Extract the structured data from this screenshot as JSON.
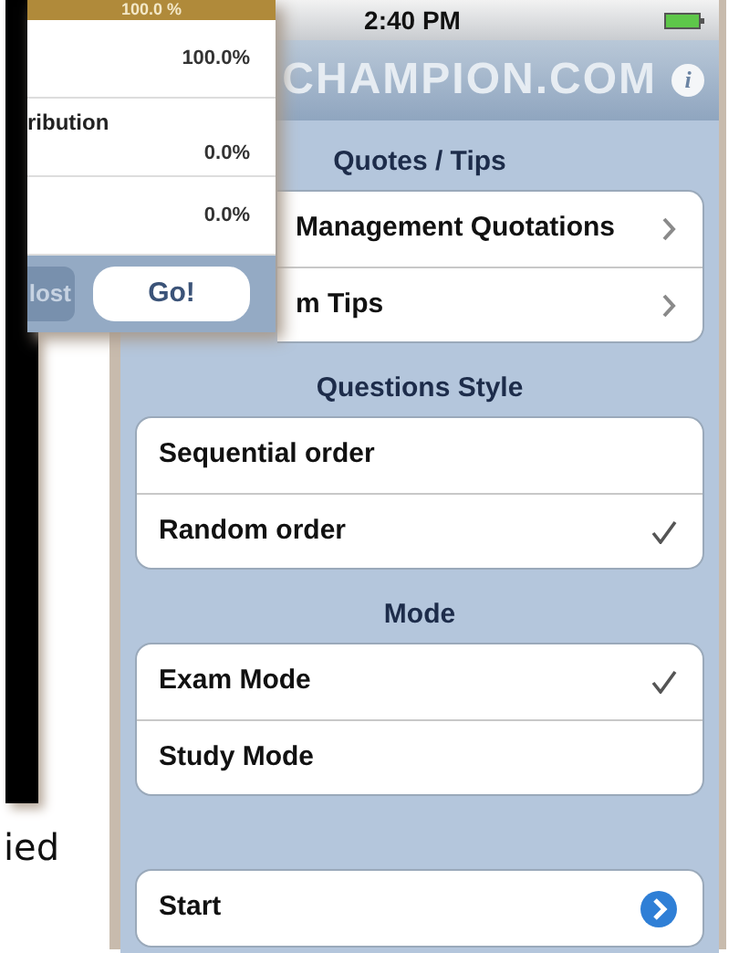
{
  "back_screen": {
    "header": "100.0 %",
    "rows": [
      {
        "label": "",
        "value": "100.0%"
      },
      {
        "label": "ribution",
        "value": "0.0%"
      },
      {
        "label": "",
        "value": "0.0%"
      }
    ],
    "buttons": [
      {
        "label": "lost",
        "kind": "secondary"
      },
      {
        "label": "Go!",
        "kind": "primary"
      }
    ]
  },
  "caption": "ied",
  "phone": {
    "status_bar": {
      "time": "2:40 PM"
    },
    "nav_title": "CHAMPION.COM",
    "info_button": "i",
    "sections": [
      {
        "title": "Quotes / Tips",
        "rows": [
          {
            "label": "Management Quotations",
            "kind": "chevron"
          },
          {
            "label": "m Tips",
            "kind": "chevron"
          }
        ]
      },
      {
        "title": "Questions Style",
        "rows": [
          {
            "label": "Sequential order",
            "kind": "check",
            "checked": false
          },
          {
            "label": "Random order",
            "kind": "check",
            "checked": true
          }
        ]
      },
      {
        "title": "Mode",
        "rows": [
          {
            "label": "Exam Mode",
            "kind": "check",
            "checked": true
          },
          {
            "label": "Study Mode",
            "kind": "check",
            "checked": false
          }
        ]
      },
      {
        "rows": [
          {
            "label": "Start",
            "kind": "disclosure"
          }
        ]
      }
    ]
  }
}
